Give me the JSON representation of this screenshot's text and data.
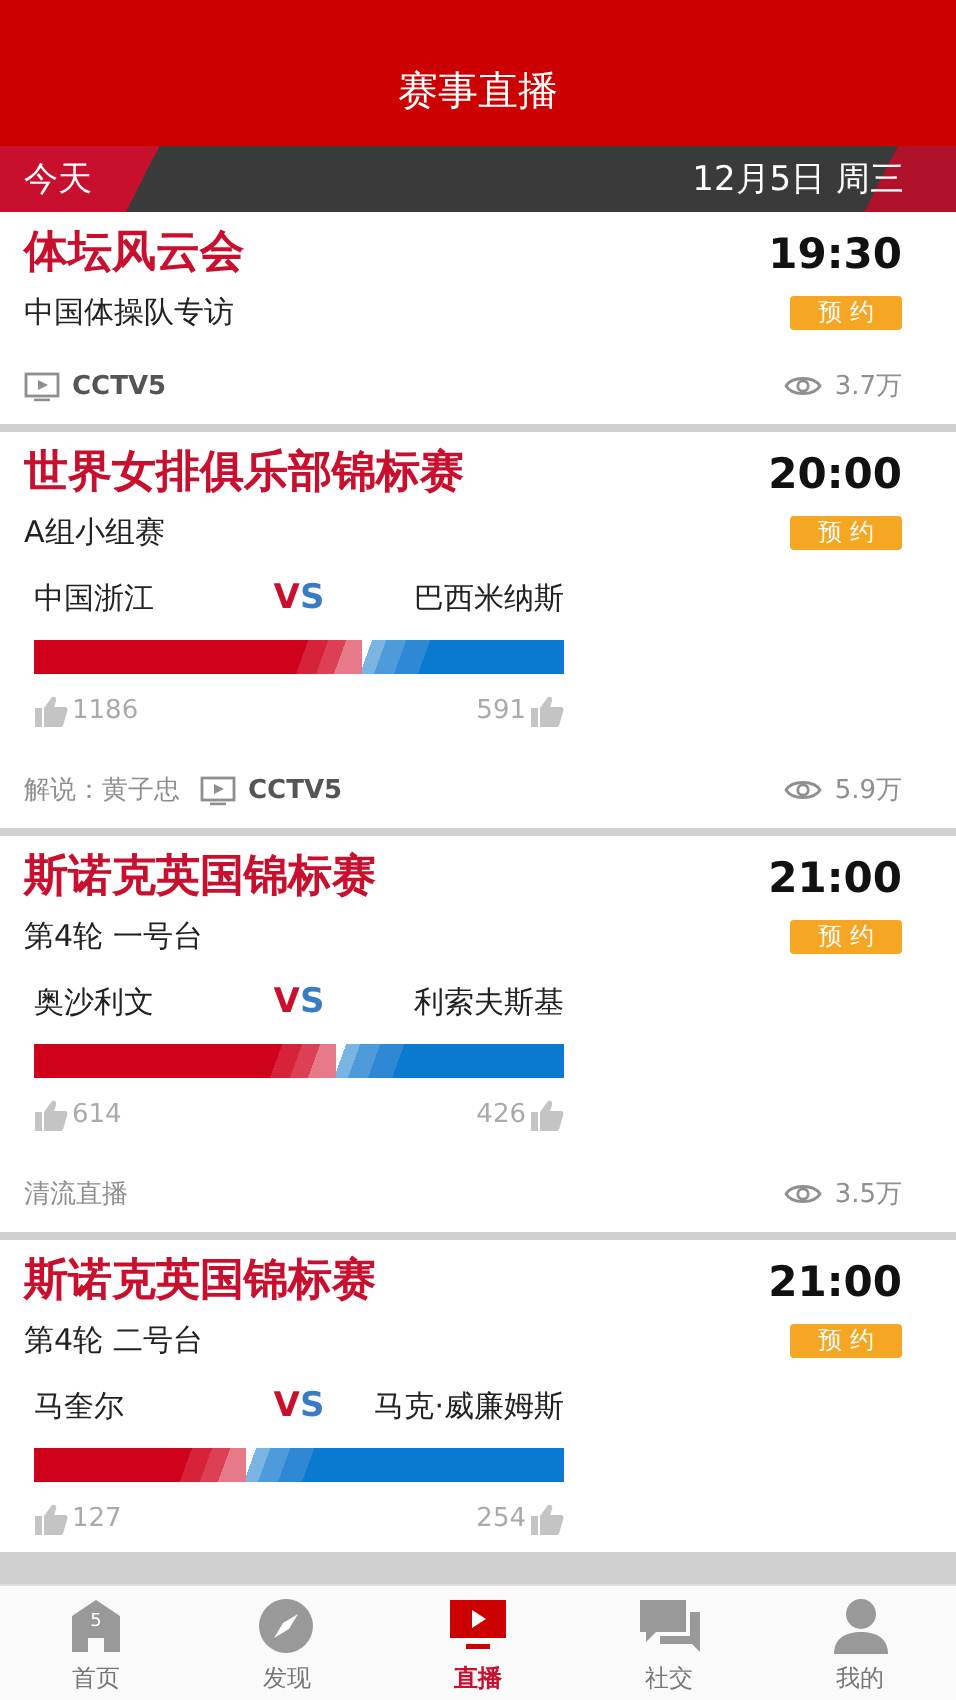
{
  "header": {
    "title": "赛事直播"
  },
  "date_bar": {
    "today": "今天",
    "date": "12月5日 周三"
  },
  "events": [
    {
      "title": "体坛风云会",
      "time": "19:30",
      "subtitle": "中国体操队专访",
      "button": "预约",
      "channel": "CCTV5",
      "views": "3.7万"
    },
    {
      "title": "世界女排俱乐部锦标赛",
      "time": "20:00",
      "subtitle": "A组小组赛",
      "button": "预约",
      "match": {
        "home": "中国浙江",
        "vs": "VS",
        "away": "巴西米纳斯",
        "level": 0.62,
        "home_likes": "1186",
        "away_likes": "591"
      },
      "commentary": "解说：黄子忠",
      "channel": "CCTV5",
      "views": "5.9万"
    },
    {
      "title": "斯诺克英国锦标赛",
      "time": "21:00",
      "subtitle": "第4轮 一号台",
      "button": "预约",
      "match": {
        "home": "奥沙利文",
        "vs": "VS",
        "away": "利索夫斯基",
        "level": 0.57,
        "home_likes": "614",
        "away_likes": "426"
      },
      "commentary": "清流直播",
      "views": "3.5万"
    },
    {
      "title": "斯诺克英国锦标赛",
      "time": "21:00",
      "subtitle": "第4轮 二号台",
      "button": "预约",
      "match": {
        "home": "马奎尔",
        "vs": "VS",
        "away": "马克·威廉姆斯",
        "level": 0.4,
        "home_likes": "127",
        "away_likes": "254"
      }
    }
  ],
  "tabs": [
    {
      "label": "首页",
      "selected": false,
      "badge": "5"
    },
    {
      "label": "发现",
      "selected": false
    },
    {
      "label": "直播",
      "selected": true
    },
    {
      "label": "社交",
      "selected": false
    },
    {
      "label": "我的",
      "selected": false
    }
  ]
}
